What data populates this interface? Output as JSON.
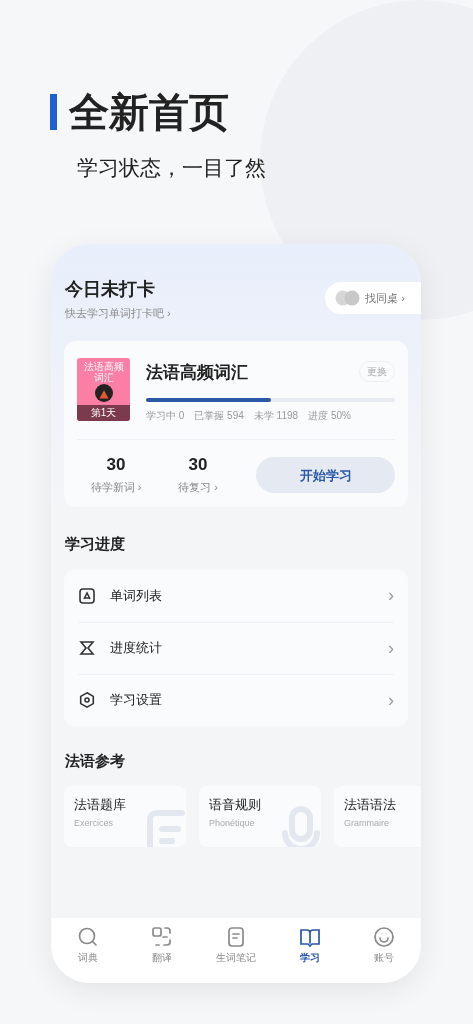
{
  "hero": {
    "title": "全新首页",
    "subtitle": "学习状态，一目了然"
  },
  "checkin": {
    "title": "今日未打卡",
    "hint": "快去学习单词打卡吧 ›",
    "partner_button": "找同桌 ›"
  },
  "book": {
    "cover_title": "法语高频词汇",
    "cover_day": "第1天",
    "name": "法语高频词汇",
    "change_button": "更换",
    "level": 0.5,
    "stats": [
      "学习中 0",
      "已掌握 594",
      "未学 1198",
      "进度 50%"
    ],
    "counts": [
      {
        "value": "30",
        "label": "待学新词 ›"
      },
      {
        "value": "30",
        "label": "待复习 ›"
      }
    ],
    "start_button": "开始学习"
  },
  "progress_section": {
    "title": "学习进度",
    "items": [
      {
        "kind": "list",
        "label": "单词列表",
        "arrow": "›"
      },
      {
        "kind": "stats",
        "label": "进度统计",
        "arrow": "›"
      },
      {
        "kind": "settings",
        "label": "学习设置",
        "arrow": "›"
      }
    ]
  },
  "reference": {
    "title": "法语参考",
    "cards": [
      {
        "kind": "exercises",
        "title": "法语题库",
        "subtitle": "Exercices"
      },
      {
        "kind": "phonetics",
        "title": "语音规则",
        "subtitle": "Phonétique"
      },
      {
        "kind": "grammar",
        "title": "法语语法",
        "subtitle": "Grammaire"
      }
    ]
  },
  "tabs": [
    {
      "kind": "dictionary",
      "label": "词典",
      "selected": false
    },
    {
      "kind": "translate",
      "label": "翻译",
      "selected": false
    },
    {
      "kind": "notes",
      "label": "生词笔记",
      "selected": false
    },
    {
      "kind": "study",
      "label": "学习",
      "selected": true
    },
    {
      "kind": "account",
      "label": "账号",
      "selected": false
    }
  ]
}
